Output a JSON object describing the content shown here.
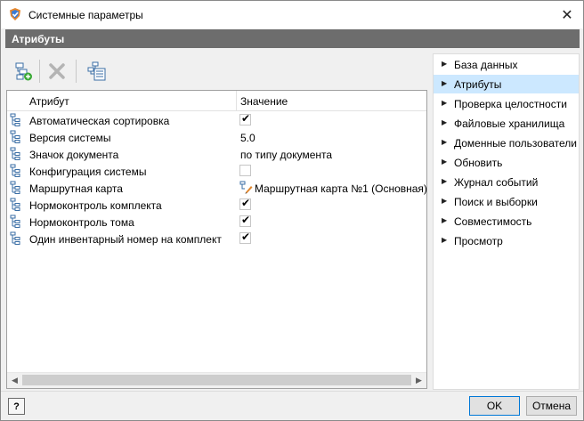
{
  "window": {
    "title": "Системные параметры",
    "close_glyph": "✕",
    "icon": "app-shield-icon"
  },
  "section_header": "Атрибуты",
  "toolbar": {
    "buttons": [
      {
        "name": "add-attribute-button",
        "icon": "add-attribute-icon"
      },
      {
        "name": "delete-button",
        "icon": "delete-x-icon",
        "disabled": true
      },
      {
        "name": "properties-button",
        "icon": "properties-icon"
      }
    ]
  },
  "grid": {
    "columns": [
      "Атрибут",
      "Значение"
    ],
    "rows": [
      {
        "attr": "Автоматическая сортировка",
        "type": "checkbox",
        "checked": true
      },
      {
        "attr": "Версия системы",
        "type": "text",
        "value": "5.0"
      },
      {
        "attr": "Значок документа",
        "type": "text",
        "value": "по типу документа"
      },
      {
        "attr": "Конфигурация системы",
        "type": "checkbox",
        "checked": false
      },
      {
        "attr": "Маршрутная карта",
        "type": "route",
        "value": "Маршрутная карта №1 (Основная)"
      },
      {
        "attr": "Нормоконтроль комплекта",
        "type": "checkbox",
        "checked": true
      },
      {
        "attr": "Нормоконтроль тома",
        "type": "checkbox",
        "checked": true
      },
      {
        "attr": "Один инвентарный номер на комплект",
        "type": "checkbox",
        "checked": true
      }
    ],
    "check_glyph": "✔"
  },
  "nav": {
    "items": [
      {
        "label": "База данных",
        "active": false
      },
      {
        "label": "Атрибуты",
        "active": true
      },
      {
        "label": "Проверка целостности",
        "active": false
      },
      {
        "label": "Файловые хранилища",
        "active": false
      },
      {
        "label": "Доменные пользователи",
        "active": false
      },
      {
        "label": "Обновить",
        "active": false
      },
      {
        "label": "Журнал событий",
        "active": false
      },
      {
        "label": "Поиск и выборки",
        "active": false
      },
      {
        "label": "Совместимость",
        "active": false
      },
      {
        "label": "Просмотр",
        "active": false
      }
    ],
    "arrow_glyph": "▶"
  },
  "footer": {
    "help_label": "?",
    "ok_label": "OK",
    "cancel_label": "Отмена"
  },
  "colors": {
    "header_band": "#6d6d6d",
    "nav_active": "#cce8ff",
    "ok_border": "#0078d7"
  }
}
